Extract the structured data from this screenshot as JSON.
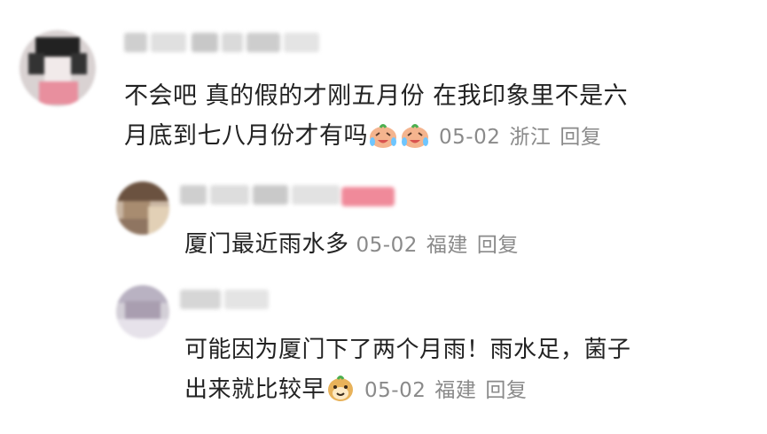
{
  "comments": [
    {
      "line1": "不会吧 真的假的才刚五月份  在我印象里不是六",
      "line2": "月底到七八月份才有吗",
      "emoji": "crying-laughing-emoji",
      "date": "05-02",
      "location": "浙江",
      "reply": "回复"
    }
  ],
  "replies": [
    {
      "text": "厦门最近雨水多",
      "date": "05-02",
      "location": "福建",
      "reply": "回复"
    },
    {
      "line1": "可能因为厦门下了两个月雨！雨水足，菌子",
      "line2": "出来就比较早",
      "emoji": "smiling-dog-emoji",
      "date": "05-02",
      "location": "福建",
      "reply": "回复"
    }
  ],
  "colors": {
    "meta": "#8a8a8a",
    "text": "#222222",
    "badge": "#f08a9a"
  }
}
